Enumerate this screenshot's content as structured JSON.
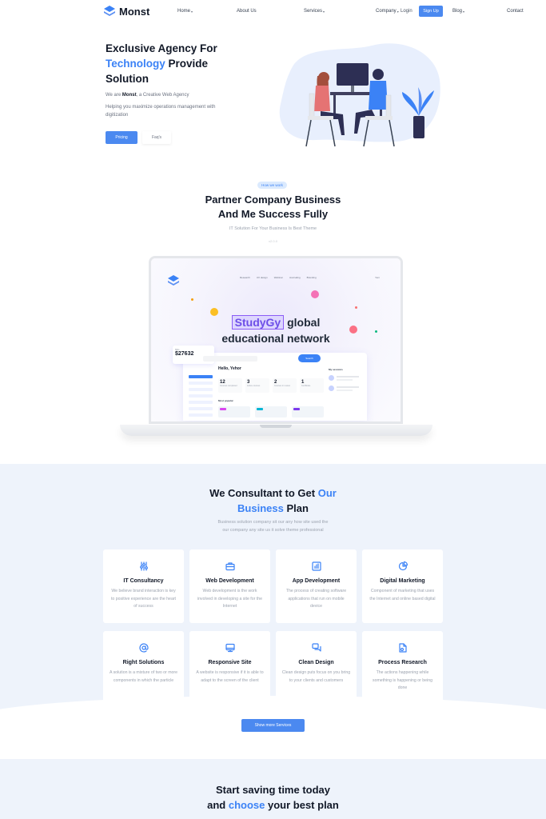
{
  "brand": {
    "name": "Monst",
    "accent": "#3b82f6",
    "button": "#4b89f0"
  },
  "nav": {
    "items": [
      {
        "label": "Home",
        "dropdown": true
      },
      {
        "label": "About Us",
        "dropdown": false
      },
      {
        "label": "Services",
        "dropdown": true
      },
      {
        "label": "Company",
        "dropdown": true
      },
      {
        "label": "Blog",
        "dropdown": true
      },
      {
        "label": "Contact",
        "dropdown": false
      }
    ],
    "login": "Login",
    "signup": "Sign Up"
  },
  "hero": {
    "title_line1": "Exclusive Agency For",
    "title_accent": "Technology",
    "title_line2_rest": " Provide",
    "title_line3": "Solution",
    "sub_prefix": "We are ",
    "sub_bold": "Monst",
    "sub_suffix": ", a Creative Web Agency",
    "desc": "Helping you maximize operations management with digitization",
    "btn_primary": "Pricing",
    "btn_secondary": "Faq's"
  },
  "how": {
    "pill": "How we work",
    "title_line1": "Partner Company Business",
    "title_line2": "And Me Success Fully",
    "sub": "IT Solution For Your Business Is Best Theme",
    "note": "v2.0.0"
  },
  "mockup": {
    "nav": [
      "Research",
      "UX design",
      "Webinar",
      "Journaling",
      "Branding"
    ],
    "user": "Yeni",
    "headline_hl": "StudyGy",
    "headline_rest": " global",
    "headline_line2": "educational network",
    "card_label": "Bills",
    "card_value": "$27632",
    "search_btn": "Search",
    "hello": "Hello, Yehor",
    "stats": [
      {
        "n": "12",
        "t": "Courses completed"
      },
      {
        "n": "3",
        "t": "Active courses"
      },
      {
        "n": "2",
        "t": "Courses in review"
      },
      {
        "n": "1",
        "t": "Certificate"
      }
    ],
    "sessions_title": "My sessions",
    "most_popular": "Most popular"
  },
  "consult": {
    "title_line1_a": "We Consultant to Get ",
    "title_line1_accent": "Our",
    "title_line2_accent": "Business",
    "title_line2_rest": " Plan",
    "desc_line1": "Business solution company sit our any how site used the",
    "desc_line2": "our company any site us it solve theme professional",
    "cards": [
      {
        "icon": "sliders-icon",
        "title": "IT Consultancy",
        "desc": "We believe brand interaction is key to positive experience are the heart of success"
      },
      {
        "icon": "briefcase-icon",
        "title": "Web Development",
        "desc": "Web development is the work involved in developing a site for the Internet"
      },
      {
        "icon": "bar-chart-icon",
        "title": "App Development",
        "desc": "The process of creating software applications that run on mobile device"
      },
      {
        "icon": "pie-chart-icon",
        "title": "Digital Marketing",
        "desc": "Component of marketing that uses the Internet and online based digital"
      },
      {
        "icon": "at-sign-icon",
        "title": "Right Solutions",
        "desc": "A solution is a mixture of two or more components in which the particle"
      },
      {
        "icon": "monitor-icon",
        "title": "Responsive Site",
        "desc": "A website is responsive if it is able to adapt to the screen of the client"
      },
      {
        "icon": "chat-icon",
        "title": "Clean Design",
        "desc": "Clean design puts focus on you bring to your clients and customers"
      },
      {
        "icon": "document-icon",
        "title": "Process Research",
        "desc": "The actions happening while something is happening or being done"
      }
    ],
    "more_btn": "Show more Services"
  },
  "pricing": {
    "title_line1": "Start saving time today",
    "title_line2_a": "and ",
    "title_line2_accent": "choose",
    "title_line2_rest": " your best plan"
  }
}
